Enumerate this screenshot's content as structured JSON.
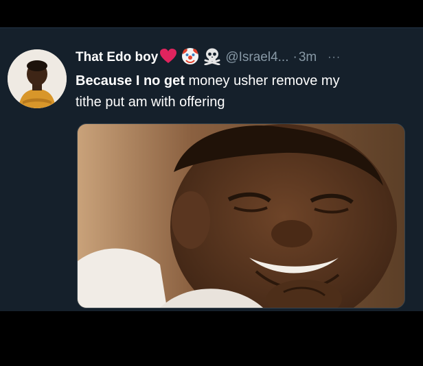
{
  "tweet": {
    "display_name": "That Edo boy",
    "badges": [
      "heart-emoji",
      "clown-emoji",
      "skull-crossbones-emoji"
    ],
    "handle": "@Israel4...",
    "separator": "·",
    "time": "3m",
    "more_label": "···",
    "text_parts": {
      "bold": "Because I no get",
      "rest_line1": " money usher remove my",
      "line2": "tithe put am with offering"
    }
  },
  "colors": {
    "background": "#15202b",
    "primary_text": "#ffffff",
    "secondary_text": "#8899a6",
    "heart": "#e0245e"
  },
  "media": {
    "type": "photo"
  }
}
